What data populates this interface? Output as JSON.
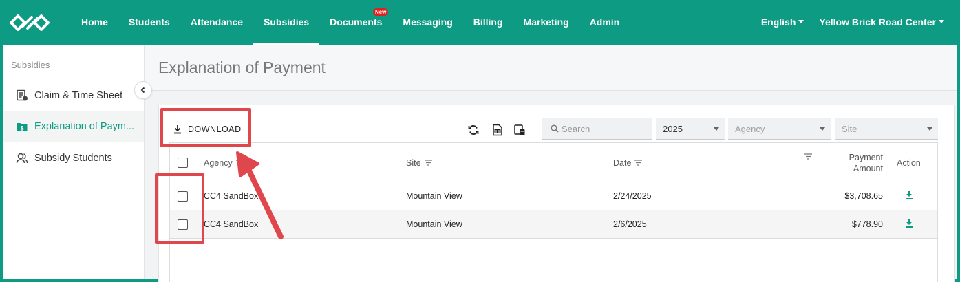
{
  "header": {
    "nav": [
      {
        "label": "Home"
      },
      {
        "label": "Students"
      },
      {
        "label": "Attendance"
      },
      {
        "label": "Subsidies",
        "active": true
      },
      {
        "label": "Documents",
        "badge": "New"
      },
      {
        "label": "Messaging"
      },
      {
        "label": "Billing"
      },
      {
        "label": "Marketing"
      },
      {
        "label": "Admin"
      }
    ],
    "language": "English",
    "center": "Yellow Brick Road Center"
  },
  "sidebar": {
    "heading": "Subsidies",
    "items": [
      {
        "label": "Claim & Time Sheet",
        "icon": "claim-sheet-icon"
      },
      {
        "label": "Explanation of Paym...",
        "icon": "dollar-folder-icon",
        "active": true
      },
      {
        "label": "Subsidy Students",
        "icon": "users-icon"
      }
    ]
  },
  "page": {
    "title": "Explanation of Payment"
  },
  "toolbar": {
    "download_label": "DOWNLOAD",
    "search_placeholder": "Search",
    "year": "2025",
    "agency_placeholder": "Agency",
    "site_placeholder": "Site"
  },
  "table": {
    "headers": {
      "agency": "Agency",
      "site": "Site",
      "date": "Date",
      "payment_amount": "Payment Amount",
      "action": "Action"
    },
    "rows": [
      {
        "agency": "CC4 SandBox",
        "site": "Mountain View",
        "date": "2/24/2025",
        "amount": "$3,708.65"
      },
      {
        "agency": "CC4 SandBox",
        "site": "Mountain View",
        "date": "2/6/2025",
        "amount": "$778.90"
      }
    ]
  },
  "colors": {
    "brand": "#0e9b83",
    "annotation": "#e0474c"
  }
}
